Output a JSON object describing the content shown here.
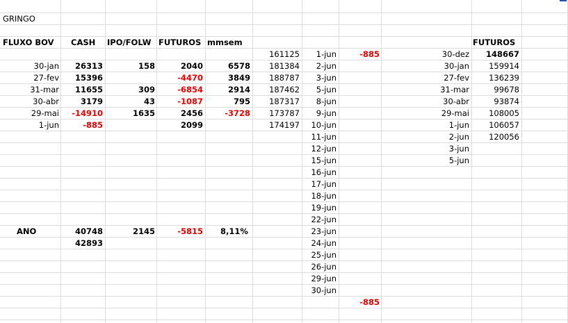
{
  "title": "GRINGO",
  "headers": {
    "fluxo": "FLUXO BOV",
    "cash": "CASH",
    "ipo": "IPO/FOLW",
    "futuros": "FUTUROS",
    "mmsem": "mmsem",
    "futuros2": "FUTUROS"
  },
  "left_rows": [
    {
      "date": "30-jan",
      "cash": "26313",
      "ipo": "158",
      "fut": "2040",
      "mm": "6578"
    },
    {
      "date": "27-fev",
      "cash": "15396",
      "ipo": "",
      "fut": "-4470",
      "mm": "3849"
    },
    {
      "date": "31-mar",
      "cash": "11655",
      "ipo": "309",
      "fut": "-6854",
      "mm": "2914"
    },
    {
      "date": "30-abr",
      "cash": "3179",
      "ipo": "43",
      "fut": "-1087",
      "mm": "795"
    },
    {
      "date": "29-mai",
      "cash": "-14910",
      "ipo": "1635",
      "fut": "2456",
      "mm": "-3728"
    },
    {
      "date": "1-jun",
      "cash": "-885",
      "ipo": "",
      "fut": "2099",
      "mm": ""
    }
  ],
  "ano": {
    "label": "ANO",
    "cash": "40748",
    "ipo": "2145",
    "fut": "-5815",
    "mm": "8,11%",
    "cash2": "42893"
  },
  "mid_values": [
    "161125",
    "181384",
    "188787",
    "187462",
    "187317",
    "173787",
    "174197"
  ],
  "june_dates": [
    "1-jun",
    "2-jun",
    "3-jun",
    "5-jun",
    "8-jun",
    "9-jun",
    "10-jun",
    "11-jun",
    "12-jun",
    "15-jun",
    "16-jun",
    "17-jun",
    "18-jun",
    "19-jun",
    "22-jun",
    "23-jun",
    "24-jun",
    "25-jun",
    "26-jun",
    "29-jun",
    "30-jun"
  ],
  "june_first_value": "-885",
  "june_total": "-885",
  "right_rows": [
    {
      "date": "30-dez",
      "val": "148667"
    },
    {
      "date": "30-jan",
      "val": "159914"
    },
    {
      "date": "27-fev",
      "val": "136239"
    },
    {
      "date": "31-mar",
      "val": "99678"
    },
    {
      "date": "30-abr",
      "val": "93874"
    },
    {
      "date": "29-mai",
      "val": "108005"
    },
    {
      "date": "1-jun",
      "val": "106057"
    },
    {
      "date": "2-jun",
      "val": "120056"
    },
    {
      "date": "3-jun",
      "val": ""
    },
    {
      "date": "5-jun",
      "val": ""
    }
  ],
  "colors": {
    "negative": "#ee0000",
    "grid": "#dcdcdc"
  }
}
